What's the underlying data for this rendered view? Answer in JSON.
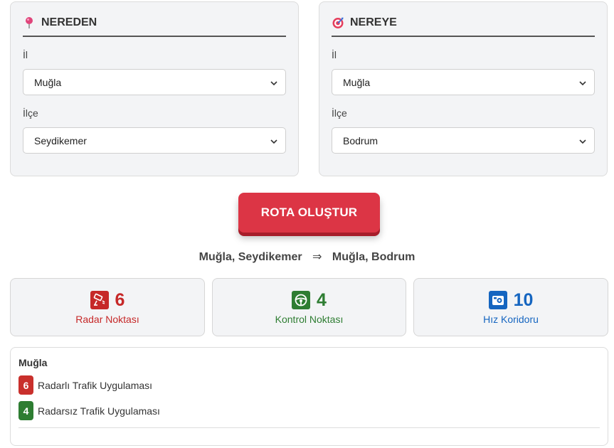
{
  "from_panel": {
    "title": "NEREDEN",
    "icon": "pin-icon",
    "province_label": "İl",
    "province_value": "Muğla",
    "district_label": "İlçe",
    "district_value": "Seydikemer"
  },
  "to_panel": {
    "title": "NEREYE",
    "icon": "target-icon",
    "province_label": "İl",
    "province_value": "Muğla",
    "district_label": "İlçe",
    "district_value": "Bodrum"
  },
  "route_button_label": "ROTA OLUŞTUR",
  "route_summary": {
    "from": "Muğla, Seydikemer",
    "arrow": "⇒",
    "to": "Muğla, Bodrum"
  },
  "stats": [
    {
      "value": "6",
      "label": "Radar Noktası",
      "color": "#c62828",
      "icon": "radar-camera-icon"
    },
    {
      "value": "4",
      "label": "Kontrol Noktası",
      "color": "#2e7d32",
      "icon": "steering-wheel-icon"
    },
    {
      "value": "10",
      "label": "Hız Koridoru",
      "color": "#1565c0",
      "icon": "speed-camera-icon"
    }
  ],
  "details": {
    "province": "Muğla",
    "items": [
      {
        "count": "6",
        "label": "Radarlı Trafik Uygulaması",
        "color": "#c9302c"
      },
      {
        "count": "4",
        "label": "Radarsız Trafik Uygulaması",
        "color": "#2e7d32"
      }
    ]
  }
}
